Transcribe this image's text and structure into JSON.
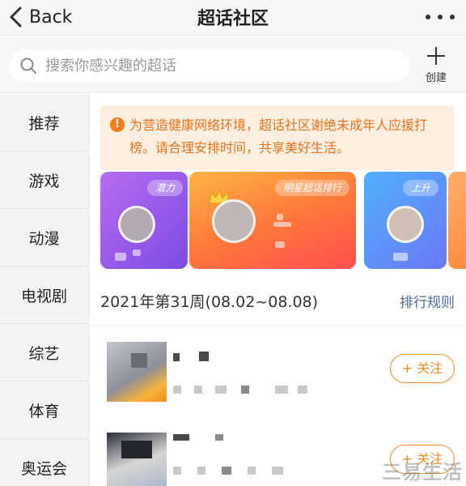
{
  "header": {
    "back_label": "Back",
    "title": "超话社区"
  },
  "search": {
    "placeholder": "搜索你感兴趣的超话",
    "value": ""
  },
  "create_label": "创建",
  "sidebar": {
    "items": [
      {
        "label": "推荐"
      },
      {
        "label": "游戏"
      },
      {
        "label": "动漫"
      },
      {
        "label": "电视剧"
      },
      {
        "label": "综艺"
      },
      {
        "label": "体育"
      },
      {
        "label": "奥运会"
      }
    ]
  },
  "notice": {
    "icon": "!",
    "text": "为营造健康网络环境，超话社区谢绝未成年人应援打榜。请合理安排时间，共享美好生活。"
  },
  "banners": [
    {
      "tag": "潜力"
    },
    {
      "tag": "明星超话排行"
    },
    {
      "tag": "上升"
    }
  ],
  "ranking": {
    "week_label": "2021年第31周(08.02~08.08)",
    "rule_link": "排行规则",
    "rows": [
      {
        "follow_label": "+ 关注"
      },
      {
        "follow_label": "+ 关注"
      }
    ]
  },
  "watermark": "三易生活",
  "colors": {
    "accent": "#f08a2b",
    "notice_bg": "#fdeee2",
    "notice_text": "#e5731a",
    "link": "#4a6aa0"
  },
  "icons": {
    "back": "chevron-left-icon",
    "more": "more-dots-icon",
    "search": "search-icon",
    "create": "plus-icon",
    "notice": "info-icon",
    "crown": "crown-icon"
  }
}
